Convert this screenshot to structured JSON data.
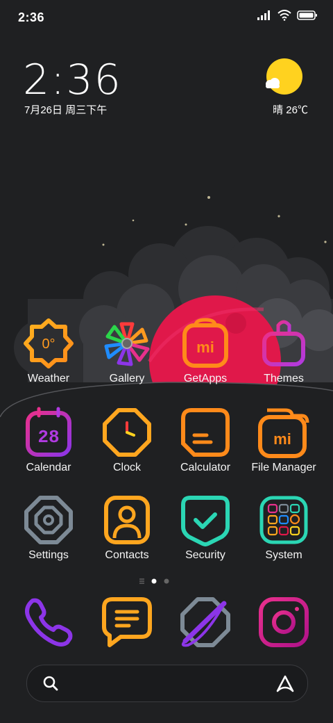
{
  "status": {
    "time": "2:36"
  },
  "clock": {
    "time": "2:36",
    "date": "7月26日 周三下午"
  },
  "weather": {
    "text": "晴 26℃",
    "icon": "sun-with-cloud-icon"
  },
  "rows": [
    [
      {
        "label": "Weather",
        "icon": "weather-icon",
        "badge": "0°"
      },
      {
        "label": "Gallery",
        "icon": "gallery-icon"
      },
      {
        "label": "GetApps",
        "icon": "getapps-icon",
        "badge": "mi"
      },
      {
        "label": "Themes",
        "icon": "themes-icon"
      }
    ],
    [
      {
        "label": "Calendar",
        "icon": "calendar-icon",
        "badge": "28"
      },
      {
        "label": "Clock",
        "icon": "clock-icon"
      },
      {
        "label": "Calculator",
        "icon": "calculator-icon"
      },
      {
        "label": "File Manager",
        "icon": "file-manager-icon",
        "badge": "mi"
      }
    ],
    [
      {
        "label": "Settings",
        "icon": "settings-icon"
      },
      {
        "label": "Contacts",
        "icon": "contacts-icon"
      },
      {
        "label": "Security",
        "icon": "security-icon"
      },
      {
        "label": "System",
        "icon": "system-folder-icon"
      }
    ]
  ],
  "dock": [
    {
      "icon": "phone-icon"
    },
    {
      "icon": "messages-icon"
    },
    {
      "icon": "browser-icon"
    },
    {
      "icon": "camera-icon"
    }
  ],
  "page_indicator": {
    "pages": 2,
    "current": 1
  },
  "colors": {
    "background": "#1f2022",
    "orange": "#ff9a1f",
    "purple": "#8c35e8",
    "pink": "#e8308c",
    "teal": "#2bd6b4",
    "red": "#e0184a",
    "sun": "#ffd21f"
  }
}
